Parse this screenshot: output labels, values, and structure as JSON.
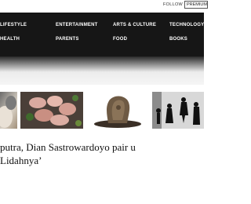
{
  "header": {
    "follow_label": "FOLLOW",
    "premium_label": "PREMIUM"
  },
  "nav": {
    "row1": [
      "LIFESTYLE",
      "ENTERTAINMENT",
      "ARTS & CULTURE",
      "TECHNOLOGY"
    ],
    "row2": [
      "HEALTH",
      "PARENTS",
      "FOOD",
      "BOOKS"
    ]
  },
  "thumbnails": [
    "person-photo",
    "raw-chicken-photo",
    "wooden-sculpture-photo",
    "silhouettes-photo"
  ],
  "article": {
    "headline_line1": "putra, Dian Sastrowardoyo pair u",
    "headline_line2": "Lidahnya’"
  },
  "colors": {
    "nav_background": "#161616",
    "nav_text": "#ffffff",
    "page_background": "#ffffff",
    "headline_text": "#111111"
  }
}
